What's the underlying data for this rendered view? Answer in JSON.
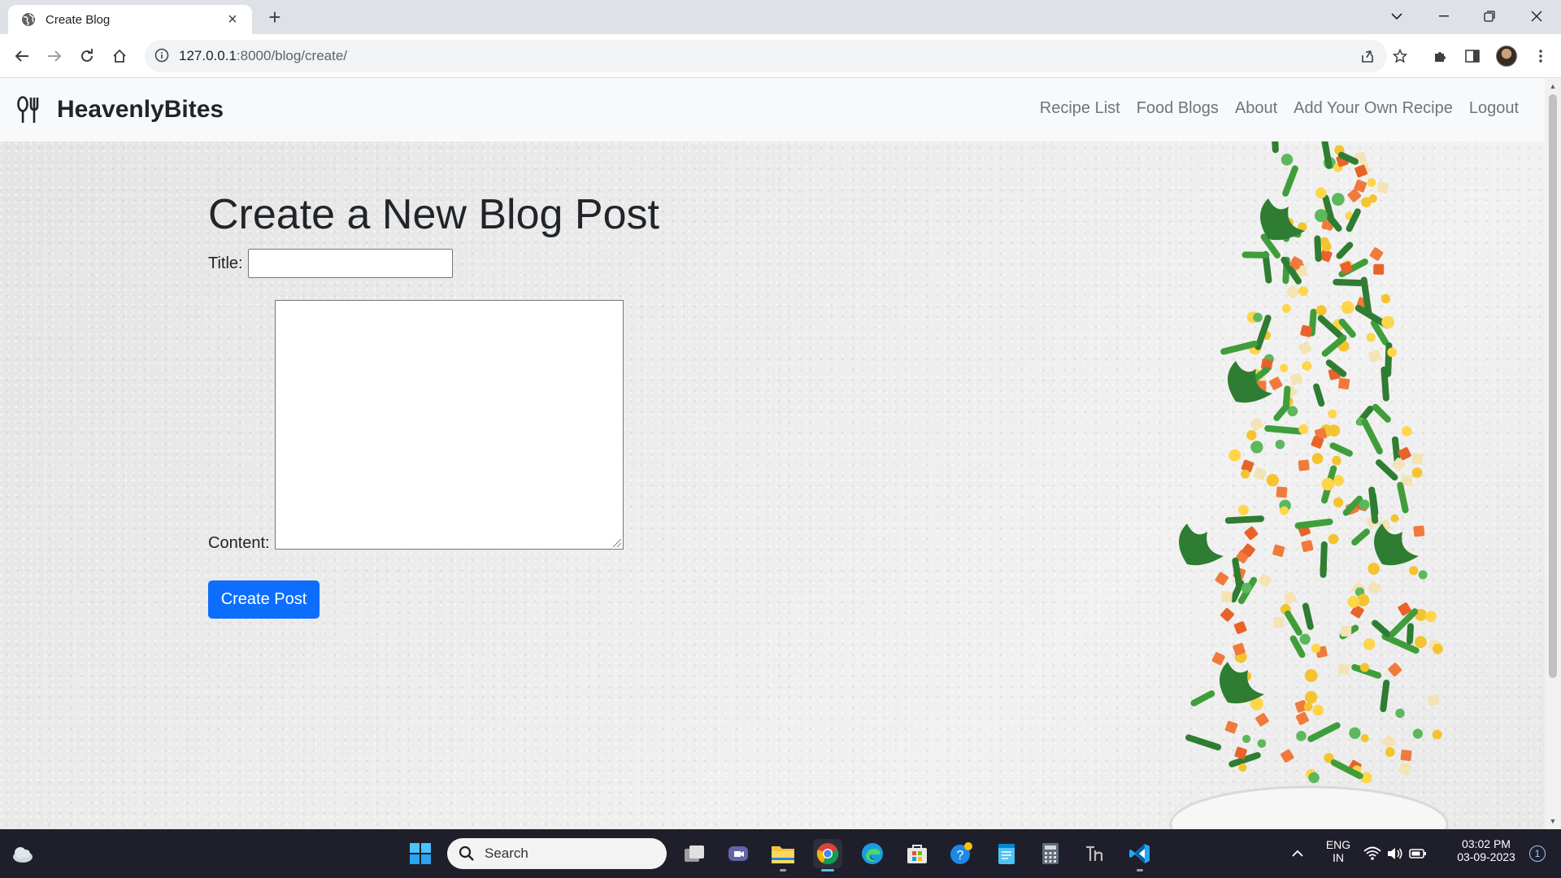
{
  "browser": {
    "tab_title": "Create Blog",
    "new_tab": "+",
    "url_host": "127.0.0.1",
    "url_path": ":8000/blog/create/"
  },
  "site": {
    "brand": "HeavenlyBites",
    "nav": [
      "Recipe List",
      "Food Blogs",
      "About",
      "Add Your Own Recipe",
      "Logout"
    ]
  },
  "form": {
    "heading": "Create a New Blog Post",
    "title_label": "Title:",
    "title_value": "",
    "content_label": "Content:",
    "content_value": "",
    "submit_label": "Create Post"
  },
  "taskbar": {
    "search_placeholder": "Search",
    "language": "ENG",
    "region": "IN",
    "time": "03:02 PM",
    "date": "03-09-2023",
    "notification_count": "1"
  },
  "colors": {
    "primary_button": "#0d6efd",
    "navbar_bg": "#f8f9fa",
    "taskbar_bg": "#1f1f2b"
  }
}
